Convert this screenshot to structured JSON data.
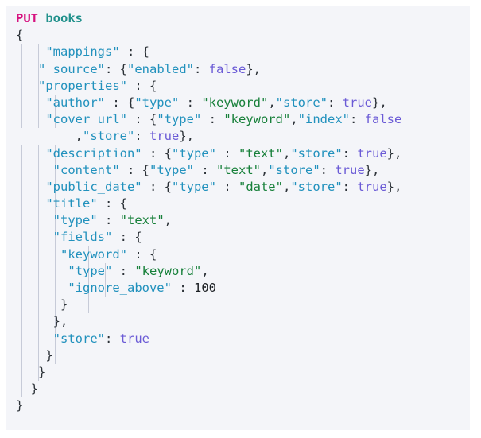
{
  "editor": {
    "kind": "code-block",
    "language": "json",
    "panel_background": "#f4f5f9",
    "page_background": "#ffffff",
    "colors": {
      "method": "#d6117f",
      "endpoint": "#21918c",
      "key": "#2191bd",
      "string": "#17803a",
      "boolean": "#6b5bd6",
      "number": "#1b1f23",
      "punctuation": "#2b3137",
      "indent_guide": "#c7cbd8"
    },
    "request": {
      "method": "PUT",
      "path": "books"
    },
    "lines": [
      {
        "indent_guides": 0,
        "tokens": [
          {
            "t": "PUT",
            "c": "method"
          },
          {
            "t": " ",
            "c": "plain"
          },
          {
            "t": "books",
            "c": "endpoint"
          }
        ]
      },
      {
        "indent_guides": 0,
        "tokens": [
          {
            "t": "{",
            "c": "punc"
          }
        ]
      },
      {
        "indent_guides": 2,
        "tokens": [
          {
            "t": "    ",
            "c": "plain"
          },
          {
            "t": "\"mappings\"",
            "c": "key"
          },
          {
            "t": " : {",
            "c": "punc"
          }
        ]
      },
      {
        "indent_guides": 2,
        "tokens": [
          {
            "t": "   ",
            "c": "plain"
          },
          {
            "t": "\"_source\"",
            "c": "key"
          },
          {
            "t": ": {",
            "c": "punc"
          },
          {
            "t": "\"enabled\"",
            "c": "key"
          },
          {
            "t": ": ",
            "c": "punc"
          },
          {
            "t": "false",
            "c": "bool"
          },
          {
            "t": "},",
            "c": "punc"
          }
        ]
      },
      {
        "indent_guides": 2,
        "tokens": [
          {
            "t": "   ",
            "c": "plain"
          },
          {
            "t": "\"properties\"",
            "c": "key"
          },
          {
            "t": " : {",
            "c": "punc"
          }
        ]
      },
      {
        "indent_guides": 3,
        "tokens": [
          {
            "t": "    ",
            "c": "plain"
          },
          {
            "t": "\"author\"",
            "c": "key"
          },
          {
            "t": " : {",
            "c": "punc"
          },
          {
            "t": "\"type\"",
            "c": "key"
          },
          {
            "t": " : ",
            "c": "punc"
          },
          {
            "t": "\"keyword\"",
            "c": "str"
          },
          {
            "t": ",",
            "c": "punc"
          },
          {
            "t": "\"store\"",
            "c": "key"
          },
          {
            "t": ": ",
            "c": "punc"
          },
          {
            "t": "true",
            "c": "bool"
          },
          {
            "t": "},",
            "c": "punc"
          }
        ]
      },
      {
        "indent_guides": 3,
        "tokens": [
          {
            "t": "    ",
            "c": "plain"
          },
          {
            "t": "\"cover_url\"",
            "c": "key"
          },
          {
            "t": " : {",
            "c": "punc"
          },
          {
            "t": "\"type\"",
            "c": "key"
          },
          {
            "t": " : ",
            "c": "punc"
          },
          {
            "t": "\"keyword\"",
            "c": "str"
          },
          {
            "t": ",",
            "c": "punc"
          },
          {
            "t": "\"index\"",
            "c": "key"
          },
          {
            "t": ": ",
            "c": "punc"
          },
          {
            "t": "false",
            "c": "bool"
          }
        ]
      },
      {
        "indent_guides": 0,
        "tokens": [
          {
            "t": "        ,",
            "c": "punc"
          },
          {
            "t": "\"store\"",
            "c": "key"
          },
          {
            "t": ": ",
            "c": "punc"
          },
          {
            "t": "true",
            "c": "bool"
          },
          {
            "t": "},",
            "c": "punc"
          }
        ]
      },
      {
        "indent_guides": 3,
        "tokens": [
          {
            "t": "    ",
            "c": "plain"
          },
          {
            "t": "\"description\"",
            "c": "key"
          },
          {
            "t": " : {",
            "c": "punc"
          },
          {
            "t": "\"type\"",
            "c": "key"
          },
          {
            "t": " : ",
            "c": "punc"
          },
          {
            "t": "\"text\"",
            "c": "str"
          },
          {
            "t": ",",
            "c": "punc"
          },
          {
            "t": "\"store\"",
            "c": "key"
          },
          {
            "t": ": ",
            "c": "punc"
          },
          {
            "t": "true",
            "c": "bool"
          },
          {
            "t": "},",
            "c": "punc"
          }
        ]
      },
      {
        "indent_guides": 4,
        "tokens": [
          {
            "t": "     ",
            "c": "plain"
          },
          {
            "t": "\"content\"",
            "c": "key"
          },
          {
            "t": " : {",
            "c": "punc"
          },
          {
            "t": "\"type\"",
            "c": "key"
          },
          {
            "t": " : ",
            "c": "punc"
          },
          {
            "t": "\"text\"",
            "c": "str"
          },
          {
            "t": ",",
            "c": "punc"
          },
          {
            "t": "\"store\"",
            "c": "key"
          },
          {
            "t": ": ",
            "c": "punc"
          },
          {
            "t": "true",
            "c": "bool"
          },
          {
            "t": "},",
            "c": "punc"
          }
        ]
      },
      {
        "indent_guides": 3,
        "tokens": [
          {
            "t": "    ",
            "c": "plain"
          },
          {
            "t": "\"public_date\"",
            "c": "key"
          },
          {
            "t": " : {",
            "c": "punc"
          },
          {
            "t": "\"type\"",
            "c": "key"
          },
          {
            "t": " : ",
            "c": "punc"
          },
          {
            "t": "\"date\"",
            "c": "str"
          },
          {
            "t": ",",
            "c": "punc"
          },
          {
            "t": "\"store\"",
            "c": "key"
          },
          {
            "t": ": ",
            "c": "punc"
          },
          {
            "t": "true",
            "c": "bool"
          },
          {
            "t": "},",
            "c": "punc"
          }
        ]
      },
      {
        "indent_guides": 3,
        "tokens": [
          {
            "t": "    ",
            "c": "plain"
          },
          {
            "t": "\"title\"",
            "c": "key"
          },
          {
            "t": " : {",
            "c": "punc"
          }
        ]
      },
      {
        "indent_guides": 4,
        "tokens": [
          {
            "t": "     ",
            "c": "plain"
          },
          {
            "t": "\"type\"",
            "c": "key"
          },
          {
            "t": " : ",
            "c": "punc"
          },
          {
            "t": "\"text\"",
            "c": "str"
          },
          {
            "t": ",",
            "c": "punc"
          }
        ]
      },
      {
        "indent_guides": 4,
        "tokens": [
          {
            "t": "     ",
            "c": "plain"
          },
          {
            "t": "\"fields\"",
            "c": "key"
          },
          {
            "t": " : {",
            "c": "punc"
          }
        ]
      },
      {
        "indent_guides": 5,
        "tokens": [
          {
            "t": "      ",
            "c": "plain"
          },
          {
            "t": "\"keyword\"",
            "c": "key"
          },
          {
            "t": " : {",
            "c": "punc"
          }
        ]
      },
      {
        "indent_guides": 6,
        "tokens": [
          {
            "t": "       ",
            "c": "plain"
          },
          {
            "t": "\"type\"",
            "c": "key"
          },
          {
            "t": " : ",
            "c": "punc"
          },
          {
            "t": "\"keyword\"",
            "c": "str"
          },
          {
            "t": ",",
            "c": "punc"
          }
        ]
      },
      {
        "indent_guides": 6,
        "tokens": [
          {
            "t": "       ",
            "c": "plain"
          },
          {
            "t": "\"ignore_above\"",
            "c": "key"
          },
          {
            "t": " : ",
            "c": "punc"
          },
          {
            "t": "100",
            "c": "num"
          }
        ]
      },
      {
        "indent_guides": 5,
        "tokens": [
          {
            "t": "      }",
            "c": "punc"
          }
        ]
      },
      {
        "indent_guides": 4,
        "tokens": [
          {
            "t": "     },",
            "c": "punc"
          }
        ]
      },
      {
        "indent_guides": 4,
        "tokens": [
          {
            "t": "     ",
            "c": "plain"
          },
          {
            "t": "\"store\"",
            "c": "key"
          },
          {
            "t": ": ",
            "c": "punc"
          },
          {
            "t": "true",
            "c": "bool"
          }
        ]
      },
      {
        "indent_guides": 3,
        "tokens": [
          {
            "t": "    }",
            "c": "punc"
          }
        ]
      },
      {
        "indent_guides": 2,
        "tokens": [
          {
            "t": "   }",
            "c": "punc"
          }
        ]
      },
      {
        "indent_guides": 1,
        "tokens": [
          {
            "t": "  }",
            "c": "punc"
          }
        ]
      },
      {
        "indent_guides": 0,
        "tokens": [
          {
            "t": "}",
            "c": "punc"
          }
        ]
      }
    ]
  }
}
